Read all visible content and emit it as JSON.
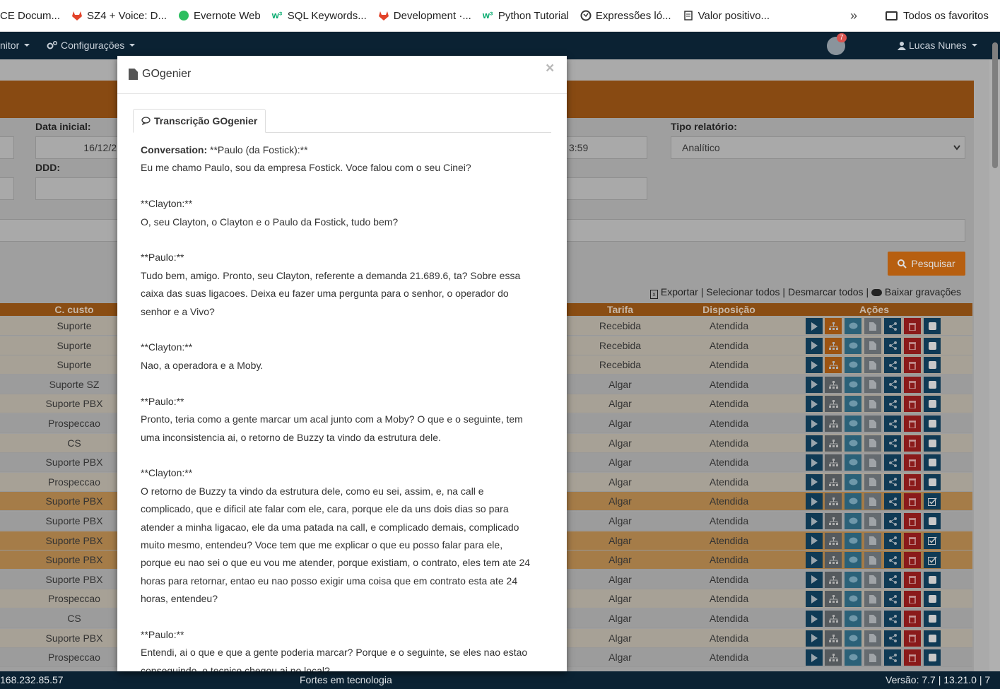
{
  "bookmarks": {
    "items": [
      {
        "label": "CE Docum...",
        "icon": "none"
      },
      {
        "label": "SZ4 + Voice: D...",
        "icon": "gitlab-icon"
      },
      {
        "label": "Evernote Web",
        "icon": "evernote-icon"
      },
      {
        "label": "SQL Keywords...",
        "icon": "w3schools-icon"
      },
      {
        "label": "Development ·...",
        "icon": "gitlab-icon"
      },
      {
        "label": "Python Tutorial",
        "icon": "w3schools-icon"
      },
      {
        "label": "Expressões ló...",
        "icon": "globe-icon"
      },
      {
        "label": "Valor positivo...",
        "icon": "page-icon"
      }
    ],
    "more": "»",
    "folder_label": "Todos os favoritos"
  },
  "navbar": {
    "monitor_label": "nitor",
    "config_label": "Configurações",
    "notifications_count": "7",
    "user_label": "Lucas Nunes"
  },
  "form": {
    "data_inicial_label": "Data inicial:",
    "data_inicial_value": "16/12/2",
    "ddd_label": "DDD:",
    "hora_value": "3:59",
    "tipo_relatorio_label": "Tipo relatório:",
    "tipo_relatorio_value": "Analítico",
    "pesquisar_label": "Pesquisar"
  },
  "actions_bar": {
    "exportar": "Exportar",
    "selecionar": "Selecionar todos",
    "desmarcar": "Desmarcar todos",
    "baixar": "Baixar gravações",
    "sep": "|"
  },
  "table": {
    "headers": {
      "custo": "C. custo",
      "tarifa": "Tarifa",
      "disposicao": "Disposição",
      "acoes": "Ações"
    },
    "rows": [
      {
        "custo": "Suporte",
        "tarifa": "Recebida",
        "disp": "Atendida",
        "style": "odd",
        "tree_orange": true,
        "checked": false
      },
      {
        "custo": "Suporte",
        "tarifa": "Recebida",
        "disp": "Atendida",
        "style": "odd",
        "tree_orange": true,
        "checked": false
      },
      {
        "custo": "Suporte",
        "tarifa": "Recebida",
        "disp": "Atendida",
        "style": "odd",
        "tree_orange": true,
        "checked": false
      },
      {
        "custo": "Suporte SZ",
        "tarifa": "Algar",
        "disp": "Atendida",
        "style": "even",
        "tree_orange": false,
        "checked": false
      },
      {
        "custo": "Suporte PBX",
        "tarifa": "Algar",
        "disp": "Atendida",
        "style": "odd",
        "tree_orange": false,
        "checked": false
      },
      {
        "custo": "Prospeccao",
        "tarifa": "Algar",
        "disp": "Atendida",
        "style": "even",
        "tree_orange": false,
        "checked": false
      },
      {
        "custo": "CS",
        "tarifa": "Algar",
        "disp": "Atendida",
        "style": "odd",
        "tree_orange": false,
        "checked": false
      },
      {
        "custo": "Suporte PBX",
        "tarifa": "Algar",
        "disp": "Atendida",
        "style": "even",
        "tree_orange": false,
        "checked": false
      },
      {
        "custo": "Prospeccao",
        "tarifa": "Algar",
        "disp": "Atendida",
        "style": "odd",
        "tree_orange": false,
        "checked": false
      },
      {
        "custo": "Suporte PBX",
        "tarifa": "Algar",
        "disp": "Atendida",
        "style": "hl",
        "tree_orange": false,
        "checked": true
      },
      {
        "custo": "Suporte PBX",
        "tarifa": "Algar",
        "disp": "Atendida",
        "style": "even",
        "tree_orange": false,
        "checked": false
      },
      {
        "custo": "Suporte PBX",
        "tarifa": "Algar",
        "disp": "Atendida",
        "style": "hl",
        "tree_orange": false,
        "checked": true
      },
      {
        "custo": "Suporte PBX",
        "tarifa": "Algar",
        "disp": "Atendida",
        "style": "hl",
        "tree_orange": false,
        "checked": true
      },
      {
        "custo": "Suporte PBX",
        "tarifa": "Algar",
        "disp": "Atendida",
        "style": "even",
        "tree_orange": false,
        "checked": false
      },
      {
        "custo": "Prospeccao",
        "tarifa": "Algar",
        "disp": "Atendida",
        "style": "odd",
        "tree_orange": false,
        "checked": false
      },
      {
        "custo": "CS",
        "tarifa": "Algar",
        "disp": "Atendida",
        "style": "even",
        "tree_orange": false,
        "checked": false
      },
      {
        "custo": "Suporte PBX",
        "tarifa": "Algar",
        "disp": "Atendida",
        "style": "odd",
        "tree_orange": false,
        "checked": false
      },
      {
        "custo": "Prospeccao",
        "tarifa": "Algar",
        "disp": "Atendida",
        "style": "even",
        "tree_orange": false,
        "checked": false
      }
    ]
  },
  "modal": {
    "title": "GOgenier",
    "close": "×",
    "tab_label": "Transcrição GOgenier",
    "conversation_label": "Conversation:",
    "transcript_lines": [
      " **Paulo (da Fostick):**\nEu me chamo Paulo, sou da empresa Fostick. Voce falou com o seu Cinei?\n\n**Clayton:**\nO, seu Clayton, o Clayton e o Paulo da Fostick, tudo bem?\n\n**Paulo:**\nTudo bem, amigo. Pronto, seu Clayton, referente a demanda 21.689.6, ta? Sobre essa\ncaixa das suas ligacoes. Deixa eu fazer uma pergunta para o senhor, o operador do\nsenhor e a Vivo?\n\n**Clayton:**\nNao, a operadora e a Moby.\n\n**Paulo:**\nPronto, teria como a gente marcar um acal junto com a Moby? O que e o seguinte, tem\numa inconsistencia ai, o retorno de Buzzy ta vindo da estrutura dele.\n\n**Clayton:**\nO retorno de Buzzy ta vindo da estrutura dele, como eu sei, assim, e, na call e\ncomplicado, que e dificil ate falar com ele, cara, porque ele da uns dois dias so para\natender a minha ligacao, ele da uma patada na call, e complicado demais, complicado\nmuito mesmo, entendeu? Voce tem que me explicar o que eu posso falar para ele,\nporque eu nao sei o que eu vou me atender, porque existiam, o contrato, eles tem ate 24\nhoras para retornar, entao eu nao posso exigir uma coisa que em contrato esta ate 24\nhoras, entendeu?\n\n**Paulo:**\nEntendi, ai o que e que a gente poderia marcar? Porque e o seguinte, se eles nao estao\nconseguindo, o tecnico chegou ai no local?"
    ]
  },
  "statusbar": {
    "ip": "168.232.85.57",
    "center": "Fortes em tecnologia",
    "version": "Versão: 7.7 | 13.21.0 | 7"
  }
}
